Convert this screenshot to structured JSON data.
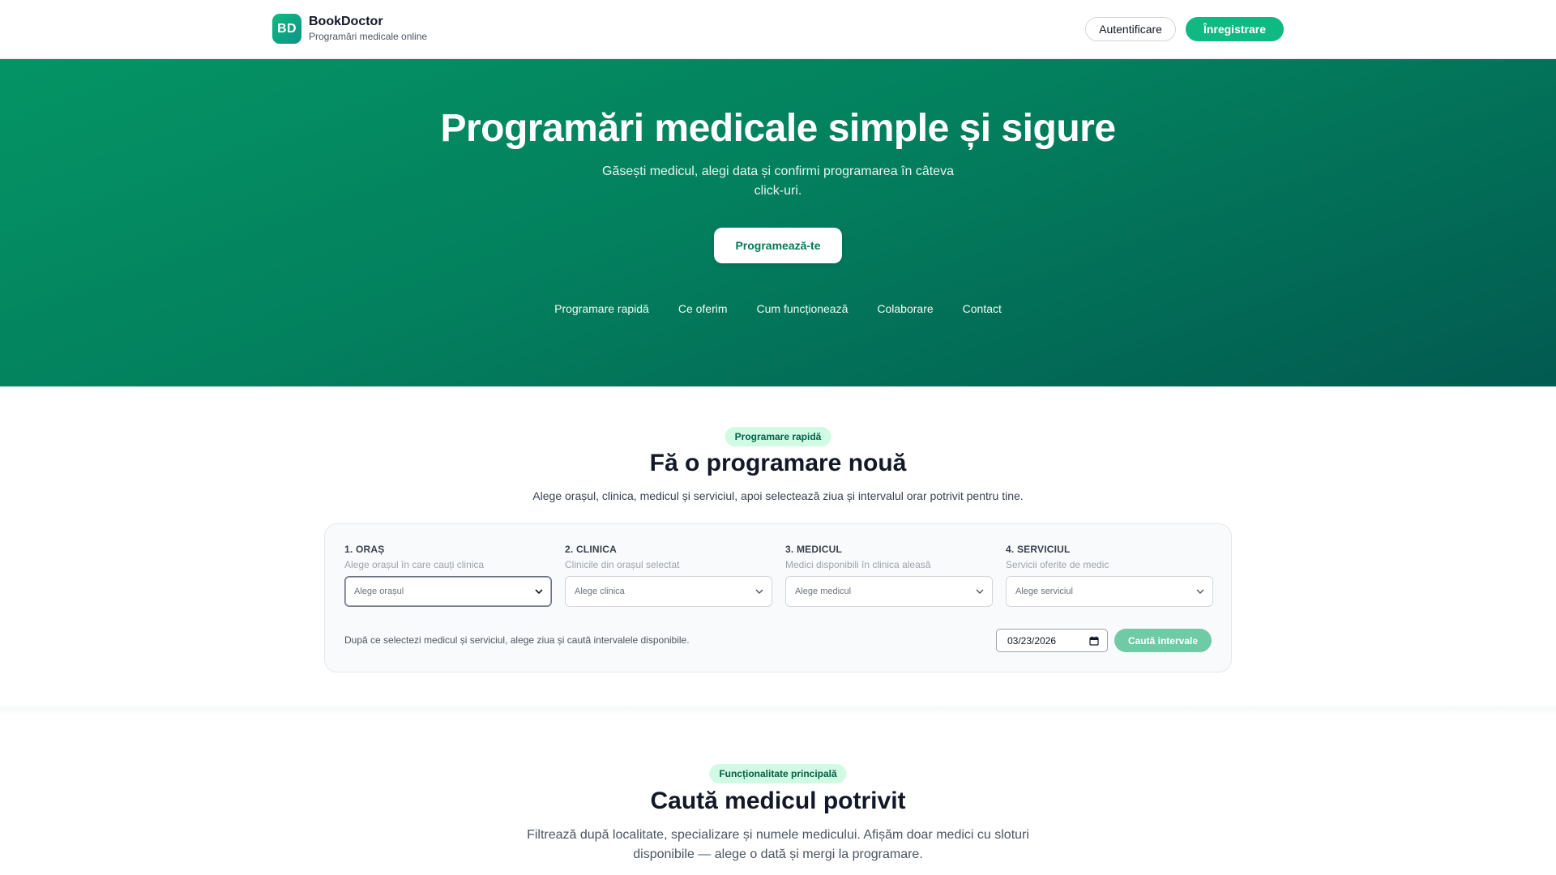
{
  "header": {
    "logo_initials": "BD",
    "brand_name": "BookDoctor",
    "tagline": "Programări medicale online",
    "login_label": "Autentificare",
    "register_label": "Înregistrare"
  },
  "hero": {
    "title": "Programări medicale simple și sigure",
    "subtitle": "Găsești medicul, alegi data și confirmi programarea în câteva click-uri.",
    "cta_label": "Programează-te",
    "nav": [
      "Programare rapidă",
      "Ce oferim",
      "Cum funcționează",
      "Colaborare",
      "Contact"
    ]
  },
  "quick_booking": {
    "pill": "Programare rapidă",
    "title": "Fă o programare nouă",
    "description": "Alege orașul, clinica, medicul și serviciul, apoi selectează ziua și intervalul orar potrivit pentru tine.",
    "fields": [
      {
        "label": "1. Oraș",
        "help": "Alege orașul în care cauți clinica",
        "placeholder": "Alege orașul"
      },
      {
        "label": "2. Clinica",
        "help": "Clinicile din orașul selectat",
        "placeholder": "Alege clinica"
      },
      {
        "label": "3. Medicul",
        "help": "Medici disponibili în clinica aleasă",
        "placeholder": "Alege medicul"
      },
      {
        "label": "4. Serviciul",
        "help": "Servicii oferite de medic",
        "placeholder": "Alege serviciul"
      }
    ],
    "hint": "După ce selectezi medicul și serviciul, alege ziua și caută intervalele disponibile.",
    "date_value": "03/23/2026",
    "search_label": "Caută intervale"
  },
  "find_doctor": {
    "pill": "Funcționalitate principală",
    "title": "Caută medicul potrivit",
    "description": "Filtrează după localitate, specializare și numele medicului. Afișăm doar medici cu sloturi disponibile — alege o dată și mergi la programare."
  },
  "colors": {
    "accent": "#10b981",
    "hero_start": "#049464",
    "hero_end": "#025a50",
    "pill_bg": "#d1fae5"
  }
}
